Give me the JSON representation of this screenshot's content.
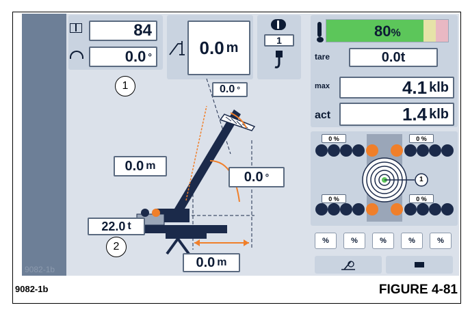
{
  "top_left": {
    "counter_value": "84",
    "slew_value": "0.0",
    "slew_unit": "°",
    "callout_1": "1"
  },
  "radius_display": {
    "value": "0.0",
    "unit": "m"
  },
  "hook_reeving": {
    "parts": "1"
  },
  "load_bar": {
    "percent": 80,
    "percent_text": "80",
    "percent_sign": "%"
  },
  "load": {
    "tare_label": "tare",
    "tare_value": "0.0t",
    "max_label": "max",
    "max_value": "4.1",
    "max_unit": "klb",
    "act_label": "act",
    "act_value": "1.4",
    "act_unit": "klb"
  },
  "outriggers": {
    "top_left_pct": "0 %",
    "top_right_pct": "0 %",
    "bottom_left_pct": "0 %",
    "bottom_right_pct": "0 %",
    "winch_marker": "1"
  },
  "percent_buttons": [
    "%",
    "%",
    "%",
    "%",
    "%"
  ],
  "crane_view": {
    "boom_angle_top": "0.0",
    "boom_angle_top_unit": "°",
    "boom_length": "0.0",
    "boom_length_unit": "m",
    "boom_angle": "0.0",
    "boom_angle_unit": "°",
    "counterweight": "22.0",
    "counterweight_unit": "t",
    "callout_2": "2",
    "radius": "0.0",
    "radius_unit": "m"
  },
  "sidebar_code": "9082-1b",
  "caption_left": "9082-1b",
  "caption_right": "FIGURE 4-81",
  "colors": {
    "accent_green": "#5cc65a",
    "accent_orange": "#f07f2a",
    "screen_bg": "#dbe1ea",
    "sidebar": "#6d7f97"
  }
}
